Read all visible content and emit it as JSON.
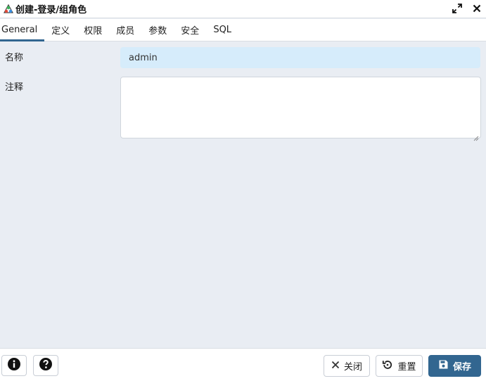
{
  "window": {
    "title": "创建-登录/组角色"
  },
  "tabs": [
    {
      "label": "General"
    },
    {
      "label": "定义"
    },
    {
      "label": "权限"
    },
    {
      "label": "成员"
    },
    {
      "label": "参数"
    },
    {
      "label": "安全"
    },
    {
      "label": "SQL"
    }
  ],
  "form": {
    "name_label": "名称",
    "name_value": "admin",
    "comment_label": "注释",
    "comment_value": ""
  },
  "footer": {
    "close_label": "关闭",
    "reset_label": "重置",
    "save_label": "保存"
  },
  "colors": {
    "primary": "#326690",
    "name_input_bg": "#d6ecfb",
    "body_bg": "#e9edf3"
  }
}
